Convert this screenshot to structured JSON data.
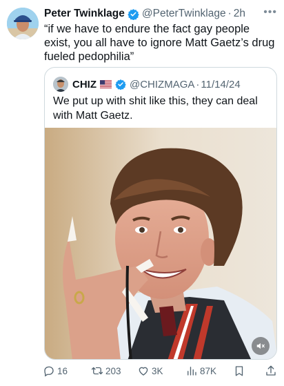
{
  "tweet": {
    "author_name": "Peter Twinklage",
    "handle": "@PeterTwinklage",
    "separator": "·",
    "time": "2h",
    "more_icon": "more-dots-icon",
    "text": "“if we have to endure the fact gay people exist, you all have to ignore Matt Gaetz’s drug fueled pedophilia”"
  },
  "quote": {
    "author_name": "CHIZ",
    "flag_icon": "us-flag-icon",
    "handle": "@CHIZMAGA",
    "separator": "·",
    "date": "11/14/24",
    "text": "We put up with shit like this, they can deal with Matt Gaetz."
  },
  "actions": {
    "replies": "16",
    "reposts": "203",
    "likes": "3K",
    "views": "87K"
  },
  "colors": {
    "verified": "#1d9bf0",
    "text": "#0f1419",
    "muted": "#536471",
    "border": "#cfd9de"
  }
}
